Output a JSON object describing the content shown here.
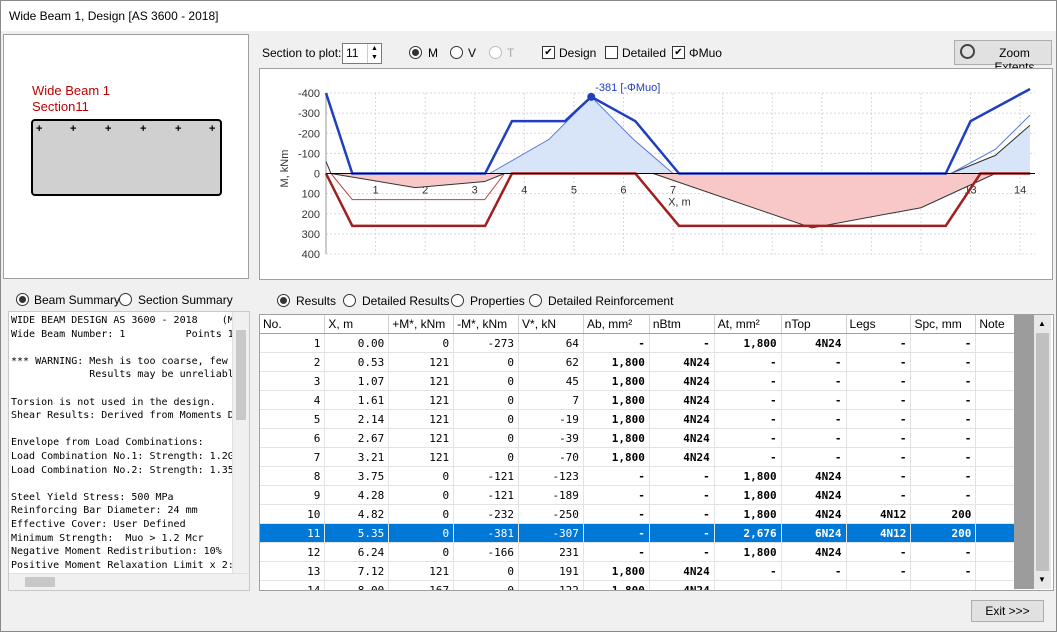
{
  "window": {
    "title": "Wide Beam 1, Design [AS 3600 - 2018]"
  },
  "section_view": {
    "label1": "Wide Beam 1",
    "label2": "Section11"
  },
  "toolbar": {
    "section_label": "Section to plot:",
    "section_value": "11",
    "radio_m": "M",
    "radio_v": "V",
    "radio_t": "T",
    "design": "Design",
    "detailed": "Detailed",
    "phimuo": "ΦMuo",
    "zoom": "Zoom Extents"
  },
  "chart": {
    "ylabel": "M, kNm",
    "xlabel": "X, m",
    "yticks": [
      "-400",
      "-300",
      "-200",
      "-100",
      "0",
      "100",
      "200",
      "300",
      "400"
    ],
    "xticks": [
      "1",
      "2",
      "3",
      "4",
      "5",
      "6",
      "7",
      "8",
      "9",
      "10",
      "11",
      "12",
      "13",
      "14"
    ],
    "annotation": "-381 [-ΦMuo]"
  },
  "chart_data": {
    "type": "line",
    "xlabel": "X, m",
    "ylabel": "M, kNm",
    "ylim": [
      400,
      -400
    ],
    "xlim": [
      0,
      14.3
    ],
    "series": [
      {
        "name": "-ΦMuo",
        "x": [
          0,
          0.53,
          3.21,
          3.75,
          4.82,
          5.35,
          6.24,
          7.12,
          12.5,
          13.0,
          14.2
        ],
        "y": [
          -400,
          0,
          0,
          -260,
          -260,
          -381,
          -260,
          0,
          0,
          -260,
          -420
        ]
      },
      {
        "name": "ΦMuo",
        "x": [
          0,
          0.53,
          3.21,
          3.75,
          6.24,
          7.12,
          12.5,
          13.2,
          14.2
        ],
        "y": [
          0,
          260,
          260,
          0,
          0,
          260,
          260,
          0,
          0
        ]
      }
    ],
    "annotation": "-381 [-ΦMuo]"
  },
  "summary_tabs": {
    "beam": "Beam Summary",
    "section": "Section Summary"
  },
  "summary_text": [
    "WIDE BEAM DESIGN AS 3600 - 2018    (Mx",
    "Wide Beam Number: 1          Points 1",
    "",
    "*** WARNING: Mesh is too coarse, few",
    "             Results may be unreliabl",
    "",
    "Torsion is not used in the design.",
    "Shear Results: Derived from Moments D",
    "",
    "Envelope from Load Combinations:",
    "Load Combination No.1: Strength: 1.2G",
    "Load Combination No.2: Strength: 1.35",
    "",
    "Steel Yield Stress: 500 MPa",
    "Reinforcing Bar Diameter: 24 mm",
    "Effective Cover: User Defined",
    "Minimum Strength:  Muo > 1.2 Mcr",
    "Negative Moment Redistribution: 10%",
    "Positive Moment Relaxation Limit x 2:",
    "Crack Control Without Direct Calculat"
  ],
  "result_tabs": {
    "results": "Results",
    "detailed": "Detailed Results",
    "properties": "Properties",
    "reinf": "Detailed Reinforcement"
  },
  "table": {
    "columns": [
      "No.",
      "X, m",
      "+M*, kNm",
      "-M*, kNm",
      "V*, kN",
      "Ab, mm²",
      "nBtm",
      "At, mm²",
      "nTop",
      "Legs",
      "Spc, mm",
      "Note"
    ],
    "rows": [
      [
        "1",
        "0.00",
        "0",
        "-273",
        "64",
        "-",
        "-",
        "1,800",
        "4N24",
        "-",
        "-",
        ""
      ],
      [
        "2",
        "0.53",
        "121",
        "0",
        "62",
        "1,800",
        "4N24",
        "-",
        "-",
        "-",
        "-",
        ""
      ],
      [
        "3",
        "1.07",
        "121",
        "0",
        "45",
        "1,800",
        "4N24",
        "-",
        "-",
        "-",
        "-",
        ""
      ],
      [
        "4",
        "1.61",
        "121",
        "0",
        "7",
        "1,800",
        "4N24",
        "-",
        "-",
        "-",
        "-",
        ""
      ],
      [
        "5",
        "2.14",
        "121",
        "0",
        "-19",
        "1,800",
        "4N24",
        "-",
        "-",
        "-",
        "-",
        ""
      ],
      [
        "6",
        "2.67",
        "121",
        "0",
        "-39",
        "1,800",
        "4N24",
        "-",
        "-",
        "-",
        "-",
        ""
      ],
      [
        "7",
        "3.21",
        "121",
        "0",
        "-70",
        "1,800",
        "4N24",
        "-",
        "-",
        "-",
        "-",
        ""
      ],
      [
        "8",
        "3.75",
        "0",
        "-121",
        "-123",
        "-",
        "-",
        "1,800",
        "4N24",
        "-",
        "-",
        ""
      ],
      [
        "9",
        "4.28",
        "0",
        "-121",
        "-189",
        "-",
        "-",
        "1,800",
        "4N24",
        "-",
        "-",
        ""
      ],
      [
        "10",
        "4.82",
        "0",
        "-232",
        "-250",
        "-",
        "-",
        "1,800",
        "4N24",
        "4N12",
        "200",
        ""
      ],
      [
        "11",
        "5.35",
        "0",
        "-381",
        "-307",
        "-",
        "-",
        "2,676",
        "6N24",
        "4N12",
        "200",
        ""
      ],
      [
        "12",
        "6.24",
        "0",
        "-166",
        "231",
        "-",
        "-",
        "1,800",
        "4N24",
        "-",
        "-",
        ""
      ],
      [
        "13",
        "7.12",
        "121",
        "0",
        "191",
        "1,800",
        "4N24",
        "-",
        "-",
        "-",
        "-",
        ""
      ],
      [
        "14",
        "8.00",
        "167",
        "0",
        "122",
        "1,800",
        "4N24",
        "-",
        "-",
        "-",
        "-",
        ""
      ]
    ]
  },
  "footer": {
    "exit": "Exit >>>"
  }
}
